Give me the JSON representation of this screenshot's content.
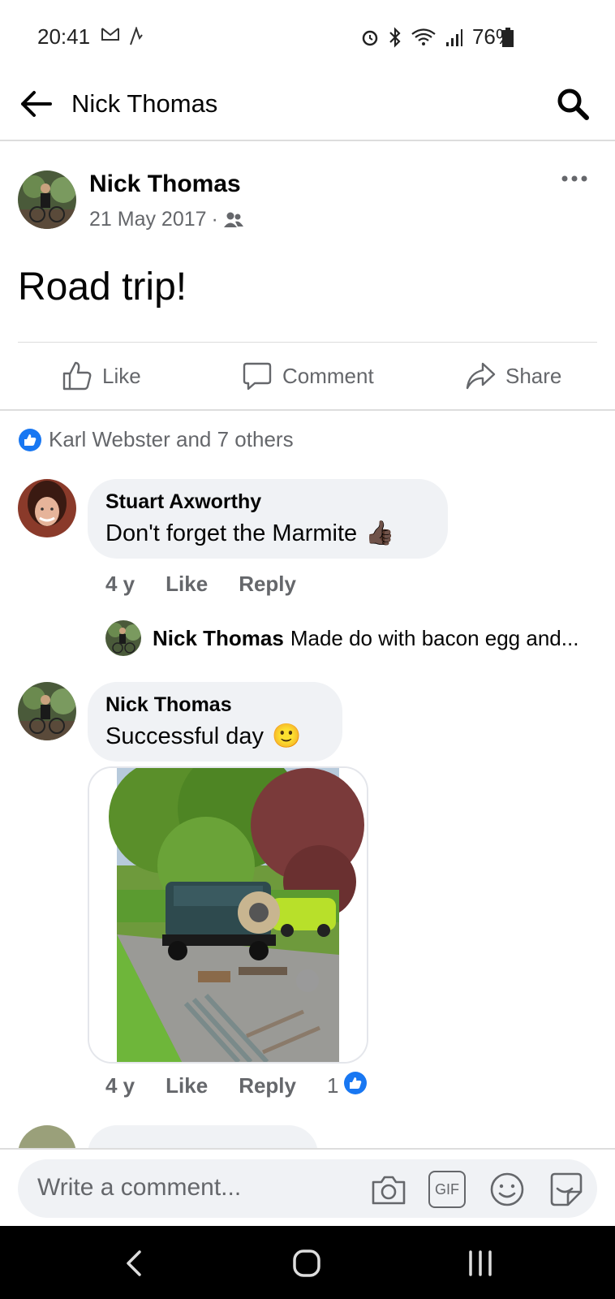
{
  "status_bar": {
    "time": "20:41",
    "left_icons": [
      "gmail-icon",
      "activity-icon"
    ],
    "right_icons": [
      "alarm-icon",
      "bluetooth-icon",
      "wifi-icon",
      "signal-icon"
    ],
    "battery": "76%"
  },
  "topbar": {
    "title": "Nick Thomas",
    "back_icon": "back-arrow-icon",
    "search_icon": "search-icon"
  },
  "post": {
    "author": "Nick Thomas",
    "date": "21 May 2017",
    "separator": "·",
    "audience_icon": "friends-icon",
    "text": "Road trip!",
    "actions": {
      "like": "Like",
      "comment": "Comment",
      "share": "Share"
    },
    "reactions_text": "Karl Webster and 7 others"
  },
  "comments": [
    {
      "author": "Stuart Axworthy",
      "text": "Don't forget the Marmite",
      "emoji": "👍🏿",
      "time": "4 y",
      "like": "Like",
      "reply": "Reply",
      "replies": [
        {
          "author": "Nick Thomas",
          "text": "Made do with bacon egg and..."
        }
      ]
    },
    {
      "author": "Nick Thomas",
      "text": "Successful day",
      "emoji": "🙂",
      "time": "4 y",
      "like": "Like",
      "reply": "Reply",
      "reaction_count": "1",
      "has_photo": true
    }
  ],
  "compose": {
    "placeholder": "Write a comment...",
    "icons": [
      "camera-icon",
      "gif-icon",
      "emoji-icon",
      "sticker-icon"
    ],
    "gif_label": "GIF"
  },
  "colors": {
    "accent": "#1877f2",
    "secondary_text": "#65676b",
    "bubble": "#f0f2f5"
  }
}
